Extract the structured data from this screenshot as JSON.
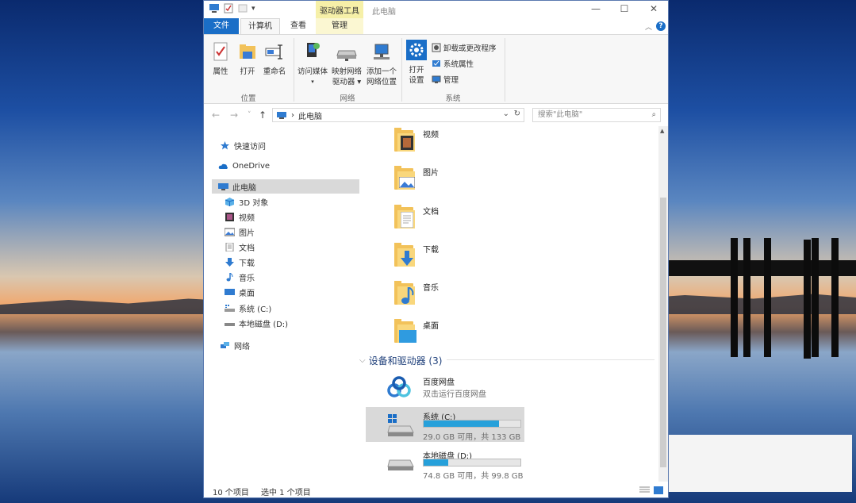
{
  "window": {
    "context_tab_header": "驱动器工具",
    "title": "此电脑",
    "controls": {
      "minimize": "—",
      "maximize": "☐",
      "close": "✕"
    }
  },
  "tabs": {
    "file": "文件",
    "computer": "计算机",
    "view": "查看",
    "manage": "管理"
  },
  "ribbon": {
    "location": {
      "properties": "属性",
      "open": "打开",
      "rename": "重命名",
      "label": "位置"
    },
    "network": {
      "access_media": "访问媒体",
      "map_drive_1": "映射网络",
      "map_drive_2": "驱动器",
      "add_location_1": "添加一个",
      "add_location_2": "网络位置",
      "label": "网络"
    },
    "system": {
      "open_settings_1": "打开",
      "open_settings_2": "设置",
      "uninstall": "卸载或更改程序",
      "sys_props": "系统属性",
      "manage": "管理",
      "label": "系统"
    }
  },
  "address": {
    "back": "←",
    "forward": "→",
    "recent": "˅",
    "up": "↑",
    "path_sep": "›",
    "path": "此电脑",
    "dropdown": "⌄",
    "refresh": "↻",
    "search_placeholder": "搜索\"此电脑\"",
    "search_icon": "⌕"
  },
  "nav": {
    "quick_access": "快速访问",
    "onedrive": "OneDrive",
    "this_pc": "此电脑",
    "objects3d": "3D 对象",
    "videos": "视频",
    "pictures": "图片",
    "documents": "文档",
    "downloads": "下载",
    "music": "音乐",
    "desktop": "桌面",
    "drive_c": "系统 (C:)",
    "drive_d": "本地磁盘 (D:)",
    "network": "网络"
  },
  "folders": [
    "视频",
    "图片",
    "文档",
    "下载",
    "音乐",
    "桌面"
  ],
  "devices_section": {
    "chevron": "⌵",
    "title": "设备和驱动器 (3)"
  },
  "devices": {
    "baidu": {
      "name": "百度网盘",
      "desc": "双击运行百度网盘"
    },
    "c": {
      "name": "系统 (C:)",
      "free": "29.0 GB 可用，共 133 GB",
      "used_fraction": 0.78
    },
    "d": {
      "name": "本地磁盘 (D:)",
      "free": "74.8 GB 可用，共 99.8 GB",
      "used_fraction": 0.25
    }
  },
  "status": {
    "items": "10 个项目",
    "selected": "选中 1 个项目"
  },
  "colors": {
    "accent": "#1a6ec7",
    "drive_bar": "#26a0da",
    "context_tab": "#f6f0a8",
    "selection": "#d9d9d9"
  }
}
